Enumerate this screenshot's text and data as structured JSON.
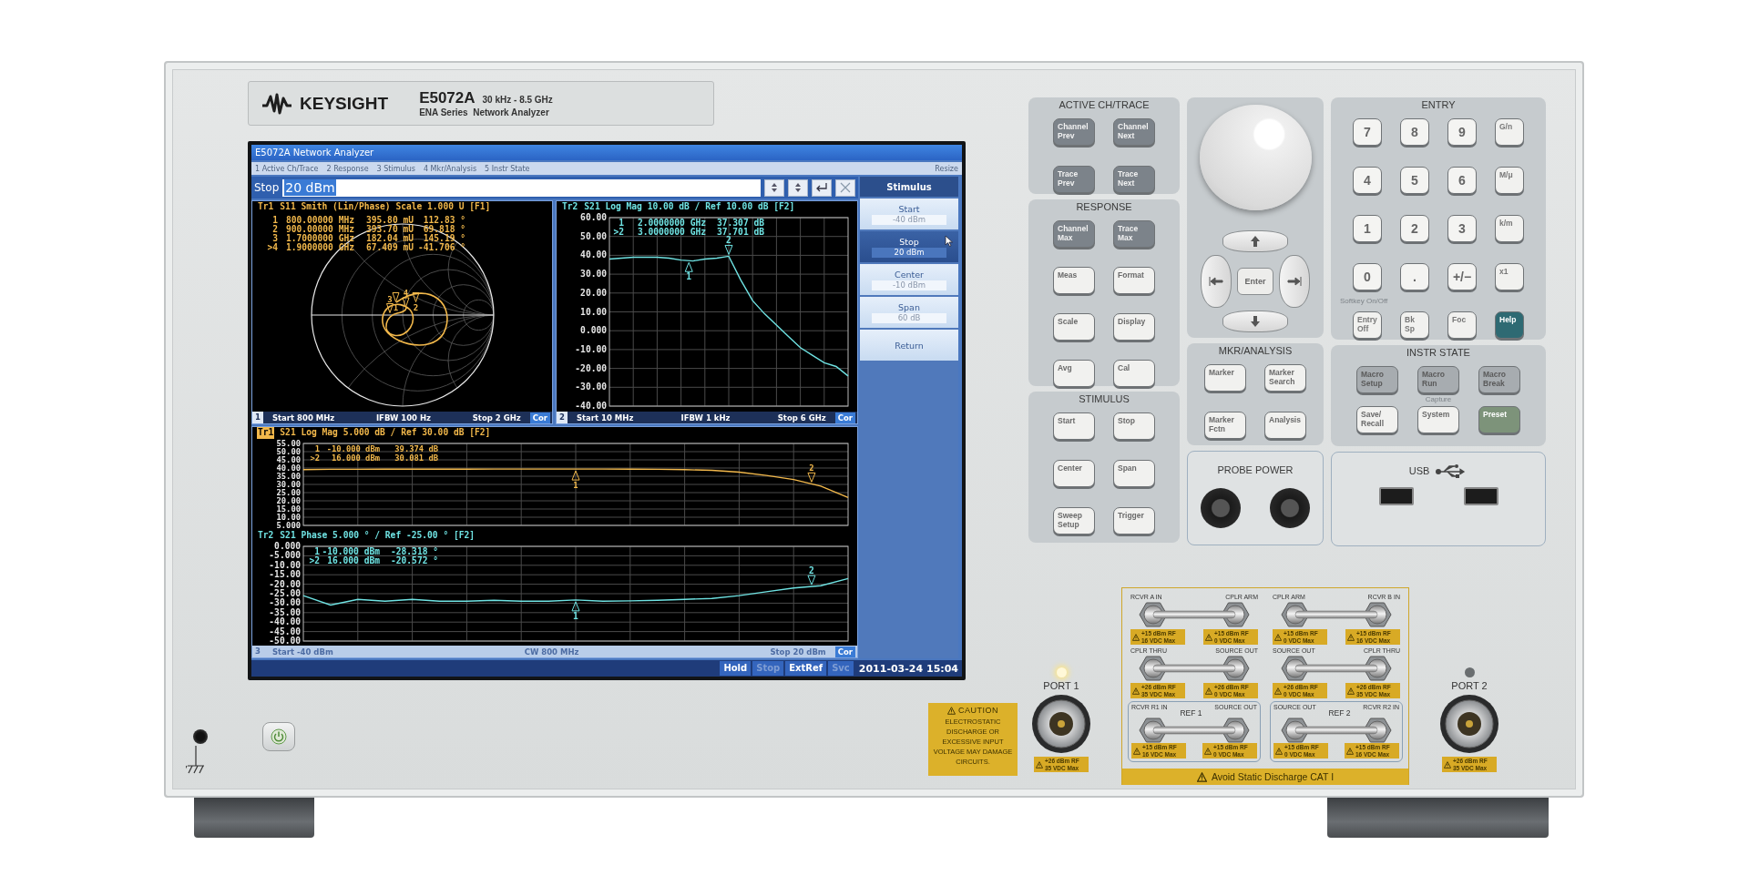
{
  "brand": {
    "name": "KEYSIGHT",
    "model": "E5072A",
    "range": "30 kHz - 8.5 GHz",
    "series": "ENA Series  Network Analyzer"
  },
  "screen": {
    "title": "E5072A Network Analyzer",
    "menu": [
      {
        "label": "1 Active Ch/Trace"
      },
      {
        "label": "2 Response"
      },
      {
        "label": "3 Stimulus"
      },
      {
        "label": "4 Mkr/Analysis"
      },
      {
        "label": "5 Instr State"
      }
    ],
    "resize": "Resize",
    "entry": {
      "label": "Stop",
      "value": "20 dBm"
    },
    "channels": [
      {
        "number": "1",
        "active": false,
        "start": "Start 800 MHz",
        "ifbw": "IFBW 100 Hz",
        "stop": "Stop 2 GHz",
        "cor": "Cor",
        "traces": [
          {
            "tag": "Tr1",
            "header": "S11 Smith (Lin/Phase) Scale 1.000 U [F1]",
            "active": false,
            "color": "#f2b84b",
            "marker_labels": [
              "1",
              "2",
              "3",
              "4"
            ],
            "markers": [
              {
                "id": "1",
                "stimulus": "800.00000 MHz",
                "values": [
                  "395.80 mU",
                  "112.83 °"
                ]
              },
              {
                "id": "2",
                "stimulus": "900.00000 MHz",
                "values": [
                  "393.70 mU",
                  "69.818 °"
                ]
              },
              {
                "id": "3",
                "stimulus": "1.7000000 GHz",
                "values": [
                  "182.04 mU",
                  "145.19 °"
                ]
              },
              {
                "id": ">4",
                "stimulus": "1.9000000 GHz",
                "values": [
                  "67.409 mU",
                  "-41.706 °"
                ]
              }
            ]
          }
        ]
      },
      {
        "number": "2",
        "active": false,
        "start": "Start 10 MHz",
        "ifbw": "IFBW 1 kHz",
        "stop": "Stop 6 GHz",
        "cor": "Cor",
        "traces": [
          {
            "tag": "Tr2",
            "header": "S21 Log Mag 10.00 dB / Ref 10.00 dB [F2]",
            "active": false,
            "markers": [
              {
                "id": "1",
                "stimulus": "2.0000000 GHz",
                "values": [
                  "37.307 dB"
                ],
                "plot_label": "1"
              },
              {
                "id": ">2",
                "stimulus": "3.0000000 GHz",
                "values": [
                  "37.701 dB"
                ],
                "plot_label": "2"
              }
            ],
            "chart_data": {
              "type": "line",
              "categories": [
                null,
                null,
                null,
                null,
                null,
                null,
                null,
                null,
                null,
                null,
                null,
                null,
                null,
                null,
                null,
                null,
                null,
                null,
                null,
                null,
                null
              ],
              "ylim": [
                -40,
                60
              ],
              "grid": true,
              "yticks": [
                {
                  "value": 60,
                  "label": "60.00"
                },
                {
                  "value": 50,
                  "label": "50.00"
                },
                {
                  "value": 40,
                  "label": "40.00"
                },
                {
                  "value": 30,
                  "label": "30.00"
                },
                {
                  "value": 20,
                  "label": "20.00"
                },
                {
                  "value": 10,
                  "label": "10.00"
                },
                {
                  "value": 0,
                  "label": "0.000"
                },
                {
                  "value": -10,
                  "label": "-10.00"
                },
                {
                  "value": -20,
                  "label": "-20.00"
                },
                {
                  "value": -30,
                  "label": "-30.00"
                },
                {
                  "value": -40,
                  "label": "-40.00"
                }
              ],
              "series": [
                {
                  "color": "#6fe3e3",
                  "values": [
                    38,
                    38.5,
                    39,
                    39,
                    39,
                    38.5,
                    37.5,
                    37,
                    38,
                    38.5,
                    39.5,
                    27,
                    16,
                    9,
                    3,
                    -3,
                    -9,
                    -13,
                    -17,
                    -19,
                    -24
                  ]
                }
              ]
            }
          }
        ]
      },
      {
        "number": "3",
        "active": true,
        "start": "Start -40 dBm",
        "ifbw": "CW 800 MHz",
        "stop": "Stop 20 dBm",
        "cor": "Cor",
        "traces": [
          {
            "tag": "Tr1",
            "header": "S21 Log Mag 5.000 dB / Ref 30.00 dB [F2]",
            "active": true,
            "markers": [
              {
                "id": "1",
                "stimulus": "-10.000 dBm",
                "values": [
                  "39.374 dB"
                ],
                "plot_label": "1"
              },
              {
                "id": ">2",
                "stimulus": "16.000 dBm",
                "values": [
                  "30.081 dB"
                ],
                "plot_label": "2"
              }
            ],
            "chart_data": {
              "type": "line",
              "categories": [
                null,
                null,
                null,
                null,
                null,
                null,
                null,
                null,
                null,
                null,
                null,
                null,
                null,
                null,
                null,
                null,
                null,
                null,
                null,
                null,
                null
              ],
              "ylim": [
                5,
                55
              ],
              "grid": true,
              "yticks": [
                {
                  "value": 55,
                  "label": "55.00"
                },
                {
                  "value": 50,
                  "label": "50.00"
                },
                {
                  "value": 45,
                  "label": "45.00"
                },
                {
                  "value": 40,
                  "label": "40.00"
                },
                {
                  "value": 35,
                  "label": "35.00"
                },
                {
                  "value": 30,
                  "label": "30.00"
                },
                {
                  "value": 25,
                  "label": "25.00"
                },
                {
                  "value": 20,
                  "label": "20.00"
                },
                {
                  "value": 15,
                  "label": "15.00"
                },
                {
                  "value": 10,
                  "label": "10.00"
                },
                {
                  "value": 5,
                  "label": "5.000"
                }
              ],
              "series": [
                {
                  "color": "#f2b84b",
                  "values": [
                    39,
                    39.2,
                    39.2,
                    39.3,
                    39.3,
                    39.3,
                    39.3,
                    39.4,
                    39.4,
                    39.4,
                    39.4,
                    39.4,
                    39.3,
                    39.2,
                    39,
                    38.6,
                    37.5,
                    35.5,
                    33,
                    29,
                    22
                  ]
                }
              ]
            }
          },
          {
            "tag": "Tr2",
            "header": "S21 Phase 5.000 ° / Ref -25.00 ° [F2]",
            "active": false,
            "markers": [
              {
                "id": "1",
                "stimulus": "-10.000 dBm",
                "values": [
                  "-28.318 °"
                ],
                "plot_label": "1"
              },
              {
                "id": ">2",
                "stimulus": "16.000 dBm",
                "values": [
                  "-20.572 °"
                ],
                "plot_label": "2"
              }
            ],
            "chart_data": {
              "type": "line",
              "categories": [
                null,
                null,
                null,
                null,
                null,
                null,
                null,
                null,
                null,
                null,
                null,
                null,
                null,
                null,
                null,
                null,
                null,
                null,
                null,
                null,
                null
              ],
              "ylim": [
                -50,
                0
              ],
              "grid": true,
              "yticks": [
                {
                  "value": 0,
                  "label": "0.000"
                },
                {
                  "value": -5,
                  "label": "-5.000"
                },
                {
                  "value": -10,
                  "label": "-10.00"
                },
                {
                  "value": -15,
                  "label": "-15.00"
                },
                {
                  "value": -20,
                  "label": "-20.00"
                },
                {
                  "value": -25,
                  "label": "-25.00"
                },
                {
                  "value": -30,
                  "label": "-30.00"
                },
                {
                  "value": -35,
                  "label": "-35.00"
                },
                {
                  "value": -40,
                  "label": "-40.00"
                },
                {
                  "value": -45,
                  "label": "-45.00"
                },
                {
                  "value": -50,
                  "label": "-50.00"
                }
              ],
              "series": [
                {
                  "color": "#6fe3e3",
                  "values": [
                    -26,
                    -31,
                    -28,
                    -29,
                    -28,
                    -29,
                    -29,
                    -28.5,
                    -29,
                    -29,
                    -28.3,
                    -29,
                    -28.8,
                    -28.5,
                    -28,
                    -27.5,
                    -26,
                    -24,
                    -22,
                    -20.8,
                    -17
                  ]
                }
              ]
            }
          }
        ]
      }
    ],
    "softkeys": {
      "title": "Stimulus",
      "items": [
        {
          "label": "Start",
          "value": "-40 dBm",
          "selected": false
        },
        {
          "label": "Stop",
          "value": "20 dBm",
          "selected": true
        },
        {
          "label": "Center",
          "value": "-10 dBm",
          "selected": false
        },
        {
          "label": "Span",
          "value": "60 dB",
          "selected": false
        },
        {
          "label": "Return",
          "selected": false
        }
      ]
    },
    "status": [
      {
        "label": "Hold",
        "disabled": false
      },
      {
        "label": "Stop",
        "disabled": true
      },
      {
        "label": "ExtRef",
        "disabled": false
      },
      {
        "label": "Svc",
        "disabled": true
      }
    ],
    "datetime": "2011-03-24 15:04"
  },
  "keypad": {
    "active": {
      "title": "ACTIVE CH/TRACE",
      "keys": [
        {
          "label": "Channel\nPrev",
          "kind": "dark"
        },
        {
          "label": "Channel\nNext",
          "kind": "dark"
        },
        {
          "label": "Trace\nPrev",
          "kind": "dark"
        },
        {
          "label": "Trace\nNext",
          "kind": "dark"
        }
      ]
    },
    "response": {
      "title": "RESPONSE",
      "keys": [
        {
          "label": "Channel\nMax",
          "kind": "dark"
        },
        {
          "label": "Trace\nMax",
          "kind": "dark"
        },
        {
          "label": "Meas",
          "kind": "light"
        },
        {
          "label": "Format",
          "kind": "light"
        },
        {
          "label": "Scale",
          "kind": "light"
        },
        {
          "label": "Display",
          "kind": "light"
        },
        {
          "label": "Avg",
          "kind": "light"
        },
        {
          "label": "Cal",
          "kind": "light"
        }
      ]
    },
    "stimulus": {
      "title": "STIMULUS",
      "keys": [
        {
          "label": "Start",
          "kind": "light"
        },
        {
          "label": "Stop",
          "kind": "light"
        },
        {
          "label": "Center",
          "kind": "light"
        },
        {
          "label": "Span",
          "kind": "light"
        },
        {
          "label": "Sweep\nSetup",
          "kind": "light"
        },
        {
          "label": "Trigger",
          "kind": "light"
        }
      ]
    },
    "nav": {
      "enter": "Enter"
    },
    "mkr": {
      "title": "MKR/ANALYSIS",
      "keys": [
        {
          "label": "Marker",
          "kind": "light"
        },
        {
          "label": "Marker\nSearch",
          "kind": "light"
        },
        {
          "label": "Marker\nFctn",
          "kind": "light"
        },
        {
          "label": "Analysis",
          "kind": "light"
        }
      ]
    },
    "probe": {
      "title": "PROBE POWER"
    },
    "entry": {
      "title": "ENTRY",
      "hint": "Softkey On/Off",
      "keys": [
        {
          "label": "7",
          "kind": "digit"
        },
        {
          "label": "8",
          "kind": "digit"
        },
        {
          "label": "9",
          "kind": "digit"
        },
        {
          "label": "G/n",
          "kind": "unit"
        },
        {
          "label": "4",
          "kind": "digit"
        },
        {
          "label": "5",
          "kind": "digit"
        },
        {
          "label": "6",
          "kind": "digit"
        },
        {
          "label": "M/μ",
          "kind": "unit"
        },
        {
          "label": "1",
          "kind": "digit"
        },
        {
          "label": "2",
          "kind": "digit"
        },
        {
          "label": "3",
          "kind": "digit"
        },
        {
          "label": "k/m",
          "kind": "unit"
        },
        {
          "label": "0",
          "kind": "digit"
        },
        {
          "label": ".",
          "kind": "digit"
        },
        {
          "label": "+/−",
          "kind": "digit"
        },
        {
          "label": "x1",
          "kind": "unit"
        },
        {
          "label": "Entry\nOff",
          "kind": "unit"
        },
        {
          "label": "Bk\nSp",
          "kind": "unit"
        },
        {
          "label": "Foc",
          "kind": "unit"
        },
        {
          "label": "Help",
          "kind": "teal"
        }
      ]
    },
    "instr": {
      "title": "INSTR STATE",
      "hint": "Capture",
      "keys": [
        {
          "label": "Macro\nSetup",
          "kind": "gray"
        },
        {
          "label": "Macro\nRun",
          "kind": "gray"
        },
        {
          "label": "Macro\nBreak",
          "kind": "gray"
        },
        {
          "label": "Save/\nRecall",
          "kind": "light"
        },
        {
          "label": "System",
          "kind": "light"
        },
        {
          "label": "Preset",
          "kind": "green"
        }
      ]
    },
    "usb": {
      "label": "USB"
    }
  },
  "connectors": {
    "ports": [
      {
        "label": "PORT 1",
        "lit": true,
        "rf": "+26 dBm RF",
        "dc": "35 VDC Max"
      },
      {
        "label": "PORT 2",
        "lit": false,
        "rf": "+26 dBm RF",
        "dc": "35 VDC Max"
      }
    ],
    "caution": {
      "title": "CAUTION",
      "text": "ELECTROSTATIC DISCHARGE OR EXCESSIVE INPUT VOLTAGE MAY DAMAGE CIRCUITS."
    },
    "rows": [
      [
        {
          "ends": [
            {
              "label": "RCVR A IN",
              "rf": "+15 dBm RF",
              "dc": "16 VDC Max"
            },
            {
              "label": "CPLR ARM",
              "rf": "+15 dBm RF",
              "dc": "0 VDC Max"
            }
          ]
        },
        {
          "ends": [
            {
              "label": "CPLR ARM",
              "rf": "+15 dBm RF",
              "dc": "0 VDC Max"
            },
            {
              "label": "RCVR B IN",
              "rf": "+15 dBm RF",
              "dc": "16 VDC Max"
            }
          ]
        }
      ],
      [
        {
          "ends": [
            {
              "label": "CPLR THRU",
              "rf": "+26 dBm RF",
              "dc": "35 VDC Max"
            },
            {
              "label": "SOURCE OUT",
              "rf": "+26 dBm RF",
              "dc": "0 VDC Max"
            }
          ]
        },
        {
          "ends": [
            {
              "label": "SOURCE OUT",
              "rf": "+26 dBm RF",
              "dc": "0 VDC Max"
            },
            {
              "label": "CPLR THRU",
              "rf": "+26 dBm RF",
              "dc": "35 VDC Max"
            }
          ]
        }
      ],
      [
        {
          "group": "REF 1",
          "ends": [
            {
              "label": "RCVR R1 IN",
              "rf": "+15 dBm RF",
              "dc": "16 VDC Max"
            },
            {
              "label": "SOURCE OUT",
              "rf": "+15 dBm RF",
              "dc": "0 VDC Max"
            }
          ]
        },
        {
          "group": "REF 2",
          "ends": [
            {
              "label": "SOURCE OUT",
              "rf": "+15 dBm RF",
              "dc": "0 VDC Max"
            },
            {
              "label": "RCVR R2 IN",
              "rf": "+15 dBm RF",
              "dc": "16 VDC Max"
            }
          ]
        }
      ]
    ],
    "banner": "Avoid Static Discharge CAT I"
  }
}
